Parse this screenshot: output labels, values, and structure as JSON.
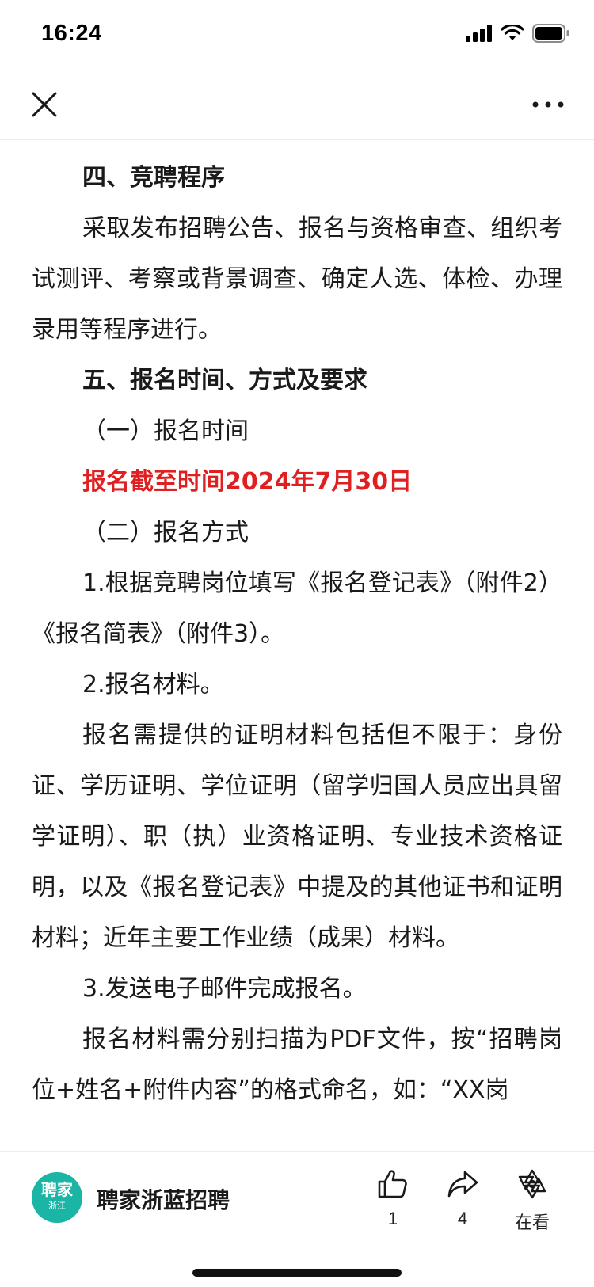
{
  "status_bar": {
    "time": "16:24"
  },
  "icons": {
    "close": "close-icon",
    "more": "more-icon",
    "like": "thumbs-up-icon",
    "share": "share-icon",
    "looking": "flower-icon"
  },
  "colors": {
    "highlight": "#e02020",
    "logo_bg": "#1ab5a5"
  },
  "article": {
    "heading_4": "四、竞聘程序",
    "para_4": "采取发布招聘公告、报名与资格审查、组织考试测评、考察或背景调查、确定人选、体检、办理录用等程序进行。",
    "heading_5": "五、报名时间、方式及要求",
    "sub_1": "（一）报名时间",
    "deadline": "报名截至时间2024年7月30日",
    "sub_2": "（二）报名方式",
    "item_1": "1.根据竞聘岗位填写《报名登记表》（附件2）《报名简表》（附件3）。",
    "item_2": "2.报名材料。",
    "para_materials": "报名需提供的证明材料包括但不限于：身份证、学历证明、学位证明（留学归国人员应出具留学证明）、职（执）业资格证明、专业技术资格证明，以及《报名登记表》中提及的其他证书和证明材料；近年主要工作业绩（成果）材料。",
    "item_3": "3.发送电子邮件完成报名。",
    "para_email": "报名材料需分别扫描为PDF文件，按“招聘岗位+姓名+附件内容”的格式命名，如：“XX岗"
  },
  "bottom_bar": {
    "logo_main": "聘家",
    "logo_sub": "浙江",
    "account_name": "聘家浙蓝招聘",
    "like_count": "1",
    "share_count": "4",
    "looking_label": "在看"
  }
}
